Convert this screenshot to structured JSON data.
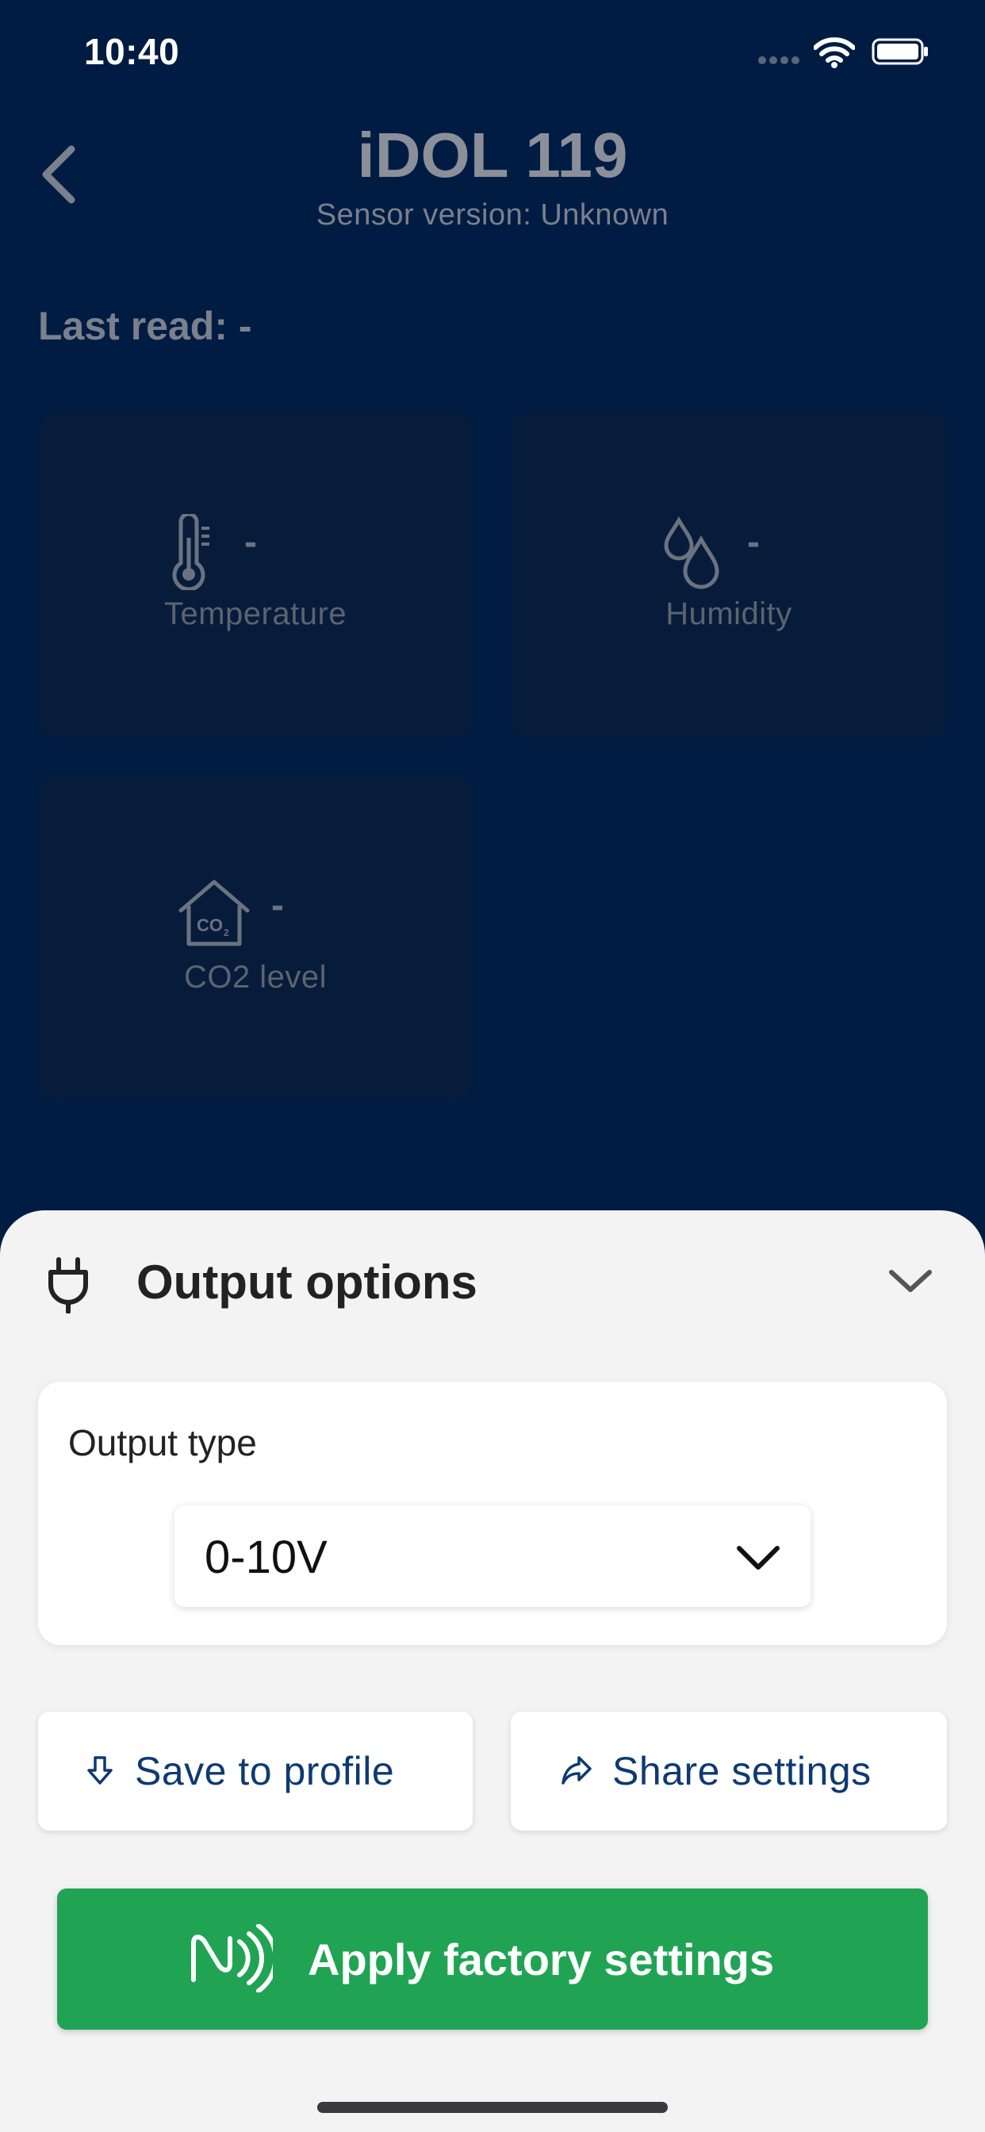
{
  "status_bar": {
    "time": "10:40"
  },
  "header": {
    "title": "iDOL 119",
    "subtitle": "Sensor version: Unknown"
  },
  "last_read": {
    "label": "Last read:",
    "value": "-"
  },
  "tiles": [
    {
      "icon": "thermometer-icon",
      "value": "-",
      "label": "Temperature"
    },
    {
      "icon": "droplets-icon",
      "value": "-",
      "label": "Humidity"
    },
    {
      "icon": "co2-house-icon",
      "value": "-",
      "label": "CO2 level"
    }
  ],
  "sheet": {
    "title": "Output options",
    "output_type_label": "Output type",
    "output_type_value": "0-10V",
    "save_label": "Save to profile",
    "share_label": "Share settings",
    "apply_label": "Apply factory settings"
  },
  "colors": {
    "background": "#001c43",
    "accent_green": "#20a454",
    "link_blue": "#0e3a73"
  }
}
